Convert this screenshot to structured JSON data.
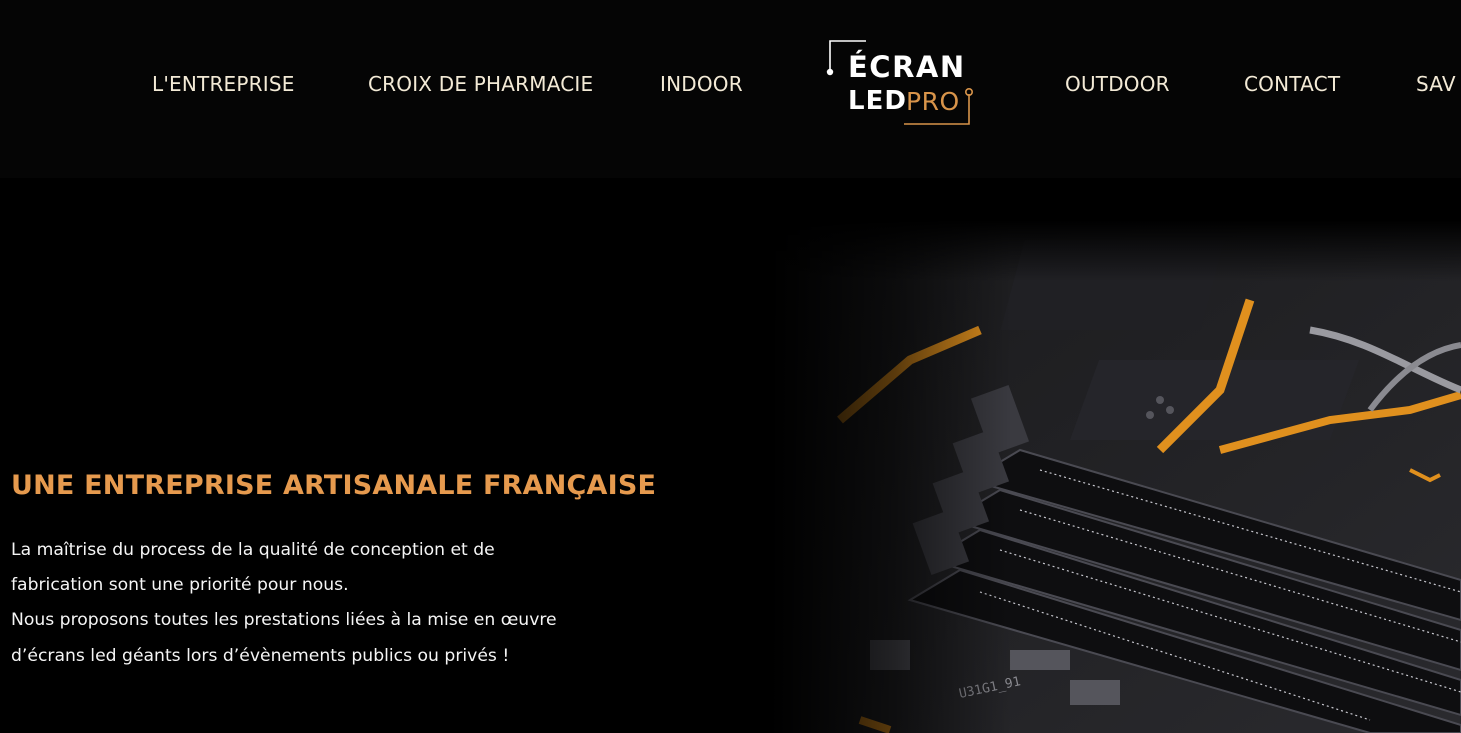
{
  "nav": {
    "items": [
      {
        "label": "L'ENTREPRISE"
      },
      {
        "label": "CROIX DE PHARMACIE"
      },
      {
        "label": "INDOOR"
      },
      {
        "label": "OUTDOOR"
      },
      {
        "label": "CONTACT"
      },
      {
        "label": "SAV"
      }
    ]
  },
  "logo": {
    "line1": "ÉCRAN",
    "line2": "LED",
    "line3": "PRO"
  },
  "hero": {
    "heading": "UNE ENTREPRISE ARTISANALE FRANÇAISE",
    "lines": [
      "La maîtrise du process de la qualité de conception et de",
      "fabrication sont une priorité pour nous.",
      "Nous proposons toutes les prestations liées à la mise en œuvre",
      "d’écrans led géants lors d’évènements publics ou privés !"
    ]
  },
  "colors": {
    "accent": "#e69a4e",
    "background": "#000000",
    "nav_text": "#f3ead6"
  }
}
